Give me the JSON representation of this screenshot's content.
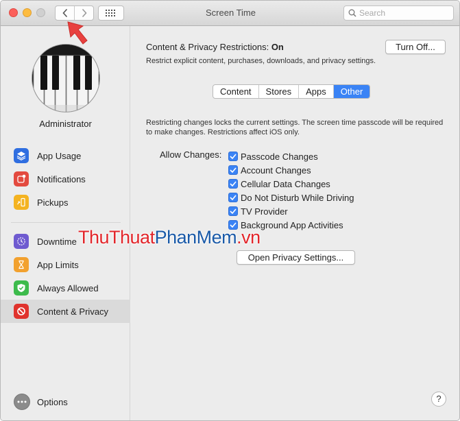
{
  "window": {
    "title": "Screen Time",
    "search_placeholder": "Search"
  },
  "sidebar": {
    "user_name": "Administrator",
    "items": [
      {
        "label": "App Usage",
        "icon": "layers-icon",
        "color": "#2f6ee0"
      },
      {
        "label": "Notifications",
        "icon": "notification-badge-icon",
        "color": "#e34a3f"
      },
      {
        "label": "Pickups",
        "icon": "phone-pickup-icon",
        "color": "#f4b321"
      },
      {
        "label": "Downtime",
        "icon": "moon-clock-icon",
        "color": "#6f5bd0"
      },
      {
        "label": "App Limits",
        "icon": "hourglass-icon",
        "color": "#f2a12f"
      },
      {
        "label": "Always Allowed",
        "icon": "checkmark-shield-icon",
        "color": "#3dbb4c"
      },
      {
        "label": "Content & Privacy",
        "icon": "no-entry-icon",
        "color": "#e0332d"
      }
    ],
    "options_label": "Options"
  },
  "main": {
    "heading_prefix": "Content & Privacy Restrictions:",
    "heading_status": "On",
    "turn_off_label": "Turn Off...",
    "description": "Restrict explicit content, purchases, downloads, and privacy settings.",
    "tabs": [
      "Content",
      "Stores",
      "Apps",
      "Other"
    ],
    "selected_tab": "Other",
    "notice": "Restricting changes locks the current settings. The screen time passcode will be required to make changes. Restrictions affect iOS only.",
    "allow_label": "Allow Changes:",
    "checks": [
      {
        "label": "Passcode Changes",
        "checked": true
      },
      {
        "label": "Account Changes",
        "checked": true
      },
      {
        "label": "Cellular Data Changes",
        "checked": true
      },
      {
        "label": "Do Not Disturb While Driving",
        "checked": true
      },
      {
        "label": "TV Provider",
        "checked": true
      },
      {
        "label": "Background App Activities",
        "checked": true
      }
    ],
    "privacy_button_label": "Open Privacy Settings...",
    "help_label": "?"
  },
  "overlay": {
    "watermark_part1": "ThuThuat",
    "watermark_part2": "PhanMem",
    "watermark_part3": ".vn"
  },
  "colors": {
    "accent": "#3a83f5",
    "watermark_red": "#e2262b",
    "watermark_blue": "#1a5aa8",
    "arrow": "#e8413f"
  }
}
